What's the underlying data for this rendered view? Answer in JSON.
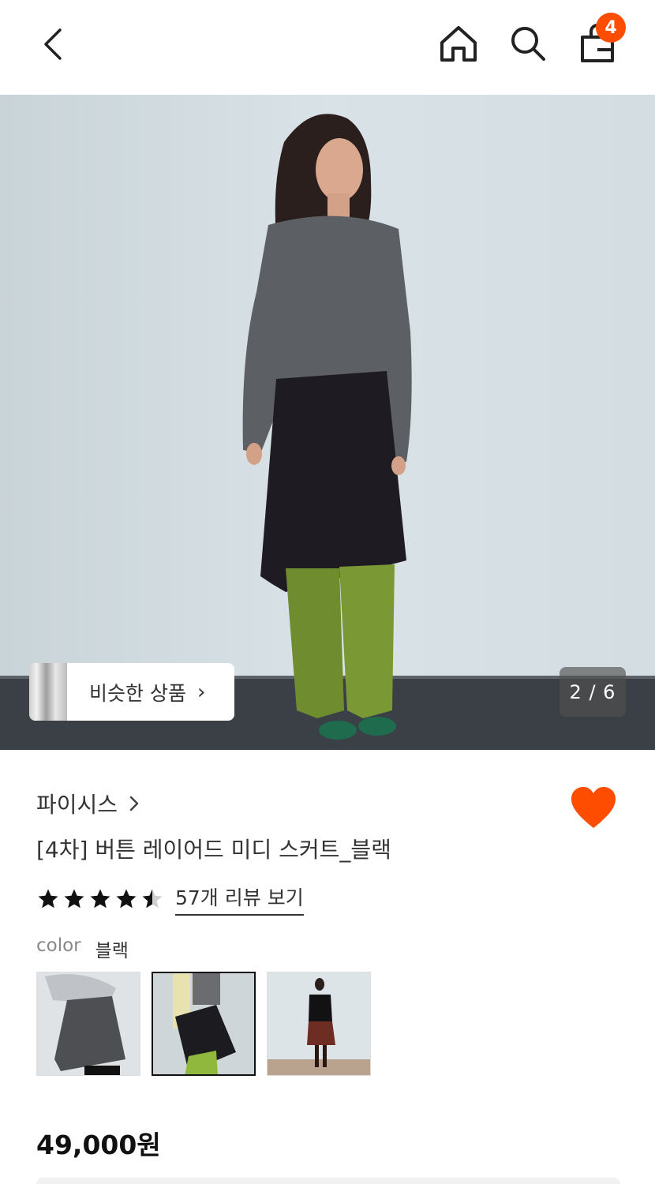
{
  "header": {
    "cart_count": "4"
  },
  "gallery": {
    "counter": "2 / 6",
    "similar_label": "비슷한 상품"
  },
  "product": {
    "brand": "파이시스",
    "title": "[4차] 버튼 레이어드 미디 스커트_블랙",
    "rating": 4.5,
    "review_link": "57개 리뷰 보기",
    "color_label": "color",
    "color_value": "블랙",
    "price": "49,000원",
    "liked": true
  },
  "colors": {
    "accent": "#ff4d00",
    "text": "#333333"
  },
  "icons": [
    "back-arrow-icon",
    "home-icon",
    "search-icon",
    "shopping-bag-icon",
    "heart-icon",
    "star-icon",
    "chevron-right-icon"
  ]
}
